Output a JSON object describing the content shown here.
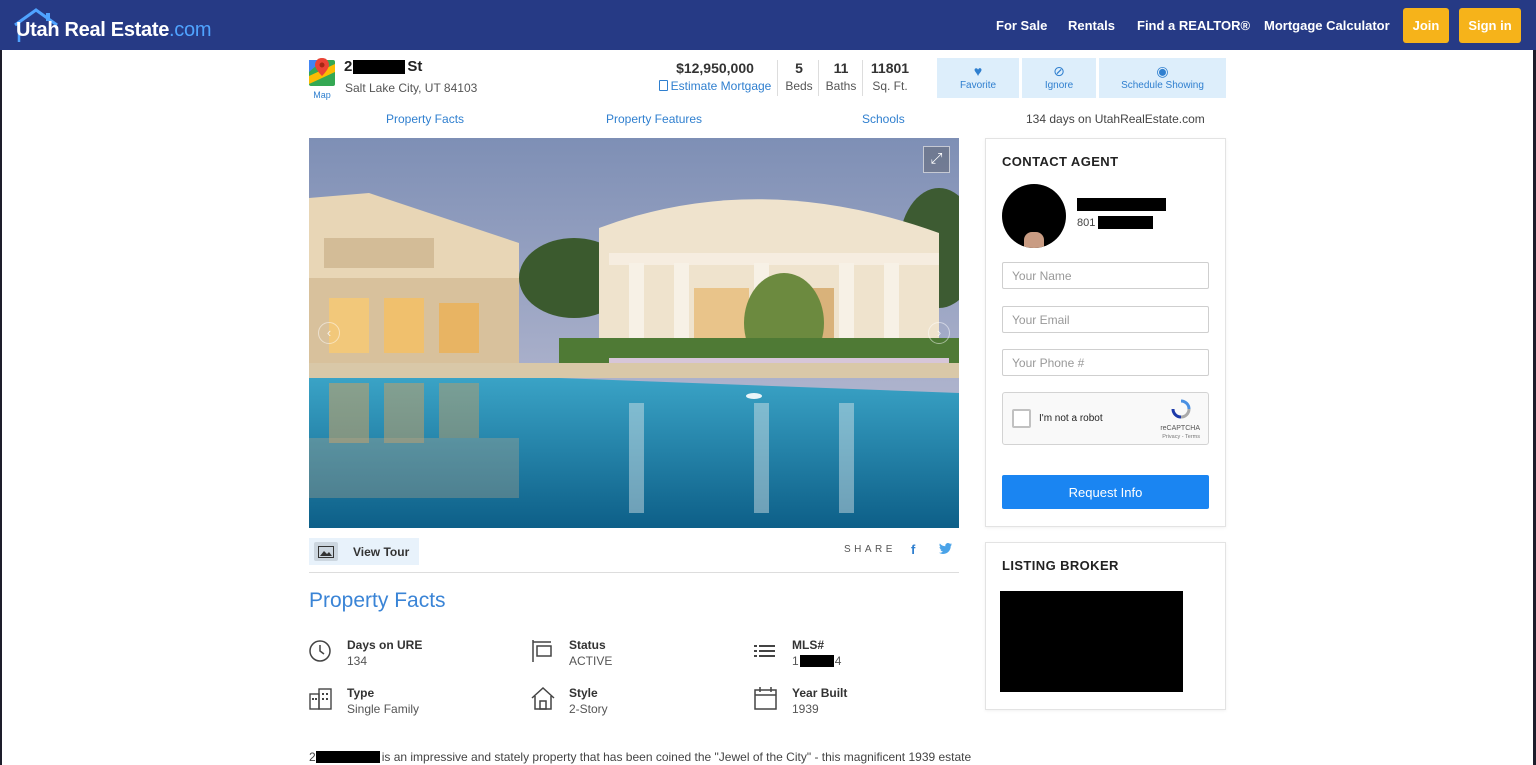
{
  "header": {
    "logo_main": "Utah Real Estate",
    "logo_suffix": ".com",
    "nav": [
      "For Sale",
      "Rentals",
      "Find a REALTOR®",
      "Mortgage Calculator"
    ],
    "join_label": "Join",
    "signin_label": "Sign in"
  },
  "listing": {
    "map_label": "Map",
    "address_prefix": "2",
    "address_suffix": "St",
    "city_line": "Salt Lake City, UT 84103",
    "price": "$12,950,000",
    "estimate_label": "Estimate Mortgage",
    "beds_value": "5",
    "beds_label": "Beds",
    "baths_value": "11",
    "baths_label": "Baths",
    "sqft_value": "11801",
    "sqft_label": "Sq. Ft.",
    "actions": {
      "favorite": "Favorite",
      "ignore": "Ignore",
      "schedule": "Schedule Showing"
    }
  },
  "tabs": [
    "Property Facts",
    "Property Features",
    "Schools"
  ],
  "days_on_site": "134 days on UtahRealEstate.com",
  "media": {
    "tour_label": "View Tour",
    "share_label": "SHARE"
  },
  "facts": {
    "title": "Property Facts",
    "items": [
      {
        "label": "Days on URE",
        "value": "134",
        "icon": "clock-icon"
      },
      {
        "label": "Status",
        "value": "ACTIVE",
        "icon": "sign-icon"
      },
      {
        "label": "MLS#",
        "value_prefix": "1",
        "value_suffix": "4",
        "icon": "list-icon"
      },
      {
        "label": "Type",
        "value": "Single Family",
        "icon": "building-icon"
      },
      {
        "label": "Style",
        "value": "2-Story",
        "icon": "house-icon"
      },
      {
        "label": "Year Built",
        "value": "1939",
        "icon": "calendar-icon"
      }
    ]
  },
  "description": {
    "prefix": "2",
    "text": "is an impressive and stately property that has been coined the \"Jewel of the City\" - this magnificent 1939 estate"
  },
  "contact": {
    "title": "CONTACT AGENT",
    "phone_prefix": "801",
    "name_placeholder": "Your Name",
    "email_placeholder": "Your Email",
    "phone_placeholder": "Your Phone #",
    "captcha_label": "I'm not a robot",
    "captcha_brand": "reCAPTCHA",
    "captcha_terms": "Privacy - Terms",
    "submit_label": "Request Info"
  },
  "broker": {
    "title": "LISTING BROKER"
  },
  "colors": {
    "header_bg": "#263a85",
    "accent_blue": "#2f7fcf",
    "button_yellow": "#f6b31a",
    "request_button": "#1a85f2"
  }
}
